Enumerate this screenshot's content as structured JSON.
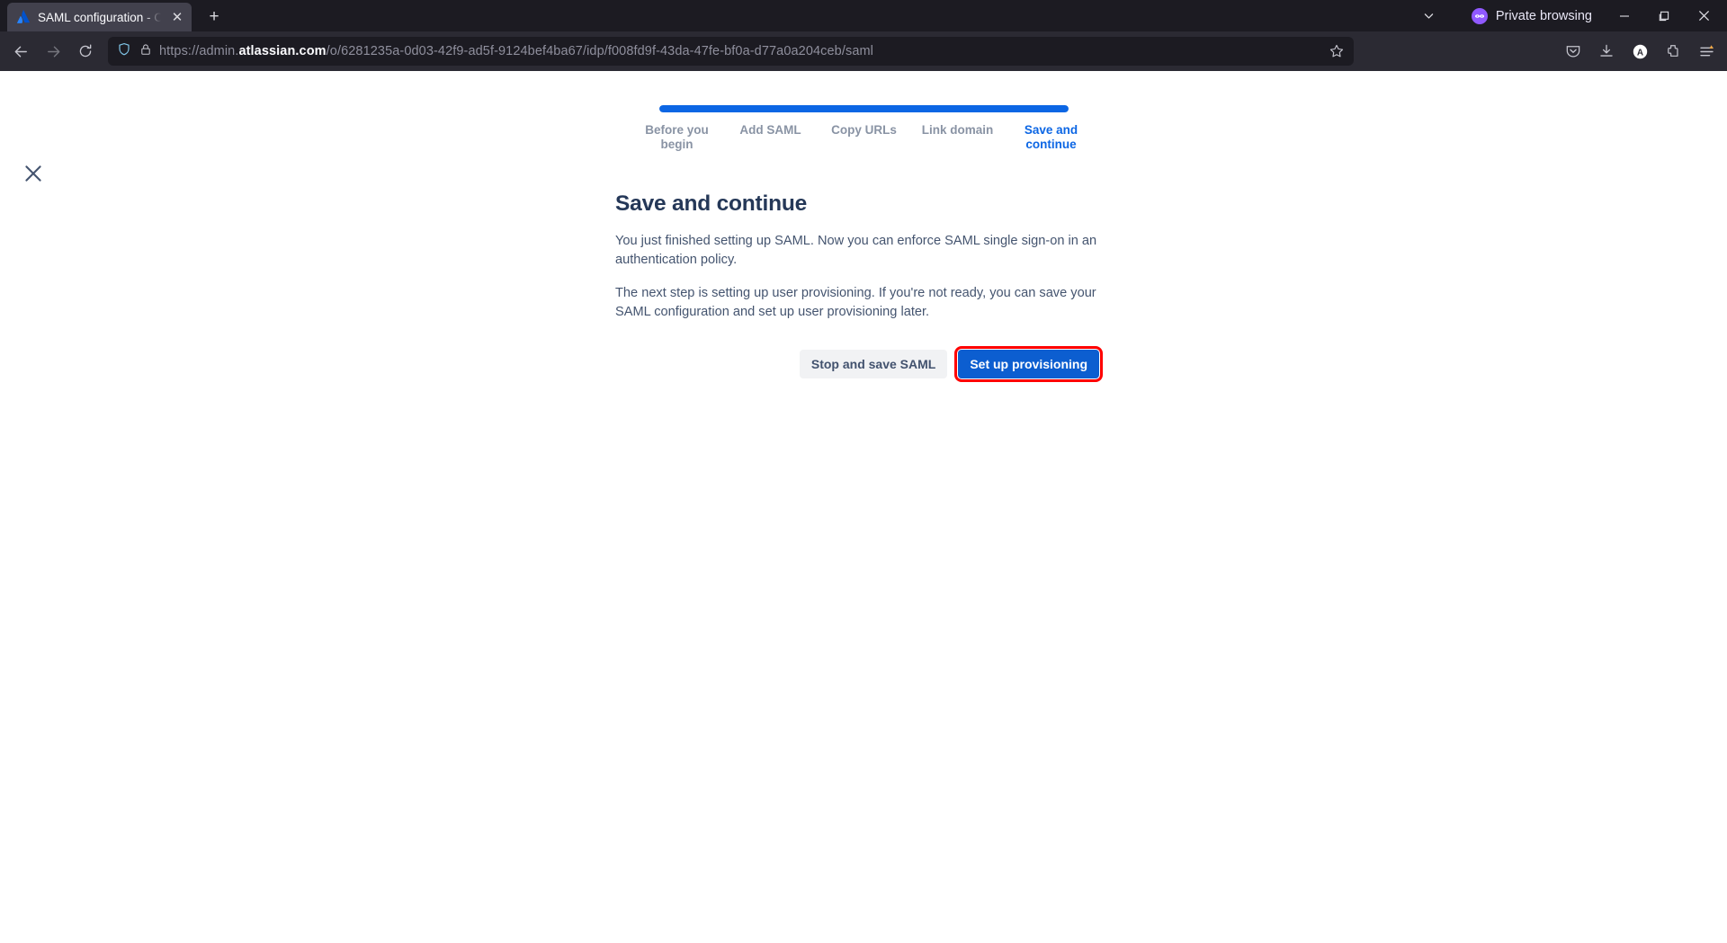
{
  "browser": {
    "tab": {
      "title": "SAML configuration - Cle",
      "favicon": "atlassian-logo-icon",
      "close_label": "✕"
    },
    "newtab_label": "+",
    "list_all_tabs_icon": "chevron-down-icon",
    "private_browsing_label": "Private browsing",
    "window_controls": {
      "minimize": "—",
      "maximize": "❐",
      "close": "✕"
    },
    "nav": {
      "back_icon": "arrow-left-icon",
      "forward_icon": "arrow-right-icon",
      "reload_icon": "reload-icon"
    },
    "url": {
      "scheme": "https://admin.",
      "domain": "atlassian.com",
      "path": "/o/6281235a-0d03-42f9-ad5f-9124bef4ba67/idp/f008fd9f-43da-47fe-bf0a-d77a0a204ceb/saml",
      "full": "https://admin.atlassian.com/o/6281235a-0d03-42f9-ad5f-9124bef4ba67/idp/f008fd9f-43da-47fe-bf0a-d77a0a204ceb/saml",
      "shield_icon": "shield-icon",
      "lock_icon": "padlock-icon",
      "bookmark_icon": "star-icon"
    },
    "toolbar_icons": [
      {
        "name": "pocket-icon"
      },
      {
        "name": "downloads-icon"
      },
      {
        "name": "account-icon",
        "label": "A"
      },
      {
        "name": "extensions-icon"
      },
      {
        "name": "application-menu-icon",
        "badge_color": "#f0a948"
      }
    ]
  },
  "page": {
    "close_icon": "close-icon",
    "wizard": {
      "progress_percent": 100,
      "steps": [
        {
          "label": "Before you begin",
          "active": false
        },
        {
          "label": "Add SAML",
          "active": false
        },
        {
          "label": "Copy URLs",
          "active": false
        },
        {
          "label": "Link domain",
          "active": false
        },
        {
          "label": "Save and continue",
          "active": true
        }
      ]
    },
    "heading": "Save and continue",
    "paragraph_1": "You just finished setting up SAML. Now you can enforce SAML single sign-on in an authentication policy.",
    "paragraph_2": "The next step is setting up user provisioning. If you're not ready, you can save your SAML configuration and set up user provisioning later.",
    "buttons": {
      "secondary": "Stop and save SAML",
      "primary": "Set up provisioning"
    }
  },
  "colors": {
    "accent_blue": "#0c66e4",
    "primary_button": "#0c5ed0",
    "highlight_outline": "#ff0000",
    "heading_text": "#253858",
    "body_text": "#44546f",
    "step_inactive": "#8993a4"
  }
}
